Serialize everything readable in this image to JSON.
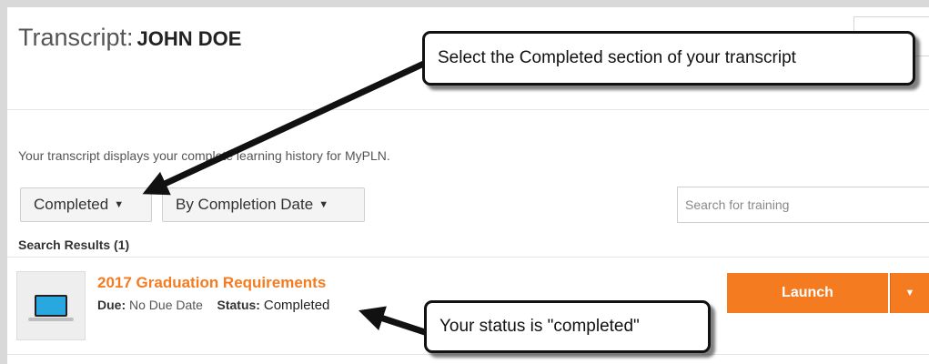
{
  "page": {
    "title": "Transcript:",
    "user_name": "JOHN DOE",
    "description": "Your transcript displays your complete learning history for MyPLN."
  },
  "filters": {
    "status_label": "Completed",
    "sort_label": "By Completion Date",
    "search_placeholder": "Search for training"
  },
  "results": {
    "label": "Search Results (1)",
    "items": [
      {
        "title": "2017 Graduation Requirements",
        "due_label": "Due:",
        "due_value": "No Due Date",
        "status_label": "Status:",
        "status_value": "Completed",
        "icon": "laptop-icon"
      }
    ]
  },
  "actions": {
    "launch_label": "Launch"
  },
  "annotations": {
    "callout_1": "Select the Completed section of your transcript",
    "callout_2": "Your status is \"completed\""
  },
  "colors": {
    "accent": "#f47b20",
    "background": "#d9d9d9",
    "panel": "#ffffff",
    "title_text": "#555555"
  }
}
